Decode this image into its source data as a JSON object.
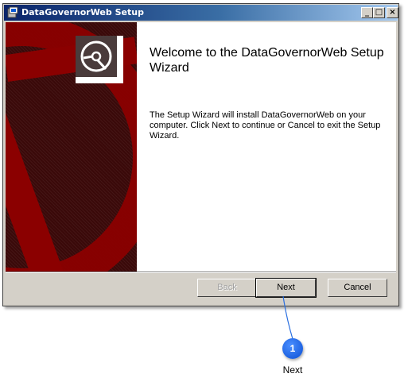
{
  "window": {
    "title": "DataGovernorWeb Setup",
    "controls": {
      "minimize": "_",
      "maximize": "□",
      "close": "×"
    }
  },
  "wizard": {
    "welcome_title": "Welcome to the DataGovernorWeb Setup Wizard",
    "description": "The Setup Wizard will install DataGovernorWeb on your computer. Click Next to continue or Cancel to exit the Setup Wizard."
  },
  "buttons": {
    "back": "Back",
    "next": "Next",
    "cancel": "Cancel"
  },
  "annotation": {
    "number": "1",
    "label": "Next"
  },
  "colors": {
    "banner_dark": "#3a0909",
    "banner_red": "#8b0000",
    "titlebar_start": "#0a246a",
    "titlebar_end": "#a6caf0",
    "callout_blue": "#0b4fd4"
  },
  "icons": {
    "app": "installer-icon",
    "logo": "cd-disc-icon"
  }
}
